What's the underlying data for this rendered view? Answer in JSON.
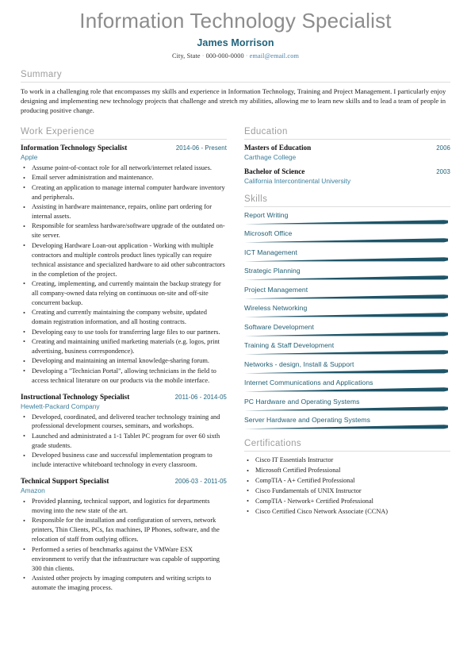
{
  "theme": {
    "accent": "#20637b",
    "accent_light": "#3b7f9c",
    "heading_gray": "#9d9d9d",
    "title_gray": "#8c8c8c",
    "bar_fill": "#1d5468",
    "link_blue": "#4a7fa8"
  },
  "header": {
    "job_title": "Information Technology Specialist",
    "name": "James Morrison",
    "location": "City, State",
    "phone": "000-000-0000",
    "email": "email@email.com",
    "separator": "·"
  },
  "summary": {
    "heading": "Summary",
    "text": "To work in a challenging role that encompasses my skills and experience in Information Technology, Training and Project Management. I particularly enjoy designing and implementing new technology projects that challenge and stretch my abilities, allowing me to learn new skills and to lead a team of people in producing positive change."
  },
  "work_experience": {
    "heading": "Work Experience",
    "entries": [
      {
        "role": "Information Technology Specialist",
        "date": "2014-06 - Present",
        "company": "Apple",
        "bullets": [
          "Assume point-of-contact role for all network/internet related issues.",
          "Email server administration and maintenance.",
          "Creating an application to manage internal computer hardware inventory and peripherals.",
          "Assisting in hardware maintenance, repairs, online part ordering for internal assets.",
          "Responsible for seamless hardware/software upgrade of the outdated on-site server.",
          "Developing Hardware Loan-out application - Working with multiple contractors and multiple controls product lines typically can require technical assistance and specialized hardware to aid other subcontractors in the completion of the project.",
          "Creating, implementing, and currently maintain the backup strategy for all company-owned data relying on continuous on-site and off-site concurrent backup.",
          "Creating and currently maintaining the company website, updated domain registration information, and all hosting contracts.",
          "Developing easy to use tools for transferring large files to our partners.",
          "Creating and maintaining unified marketing materials (e.g. logos, print advertising, business correspondence).",
          "Developing and maintaining an internal knowledge-sharing forum.",
          "Developing a \"Technician Portal\", allowing technicians in the field to access technical literature on our products via the mobile interface."
        ]
      },
      {
        "role": "Instructional Technology Specialist",
        "date": "2011-06 - 2014-05",
        "company": "Hewlett-Packard Company",
        "bullets": [
          "Developed, coordinated, and delivered teacher technology training and professional development courses, seminars, and workshops.",
          "Launched and administrated a 1-1 Tablet PC program for over 60 sixth grade students.",
          "Developed business case and successful implementation program to include interactive whiteboard technology in every classroom."
        ]
      },
      {
        "role": "Technical Support Specialist",
        "date": "2006-03 - 2011-05",
        "company": "Amazon",
        "bullets": [
          "Provided planning, technical support, and logistics for departments moving into the new state of the art.",
          "Responsible for the installation and configuration of servers, network printers, Thin Clients, PCs, fax machines, IP Phones, software, and the relocation of staff from outlying offices.",
          "Performed a series of benchmarks against the VMWare ESX environment to verify that the infrastructure was capable of supporting 300 thin clients.",
          "Assisted other projects by imaging computers and writing scripts to automate the imaging process."
        ]
      }
    ]
  },
  "education": {
    "heading": "Education",
    "entries": [
      {
        "degree": "Masters of Education",
        "year": "2006",
        "school": "Carthage College"
      },
      {
        "degree": "Bachelor of Science",
        "year": "2003",
        "school": "California Intercontinental University"
      }
    ]
  },
  "skills": {
    "heading": "Skills",
    "items": [
      {
        "name": "Report Writing"
      },
      {
        "name": "Microsoft Office"
      },
      {
        "name": "ICT Management"
      },
      {
        "name": "Strategic Planning"
      },
      {
        "name": "Project Management"
      },
      {
        "name": "Wireless Networking"
      },
      {
        "name": "Software Development"
      },
      {
        "name": "Training & Staff Development"
      },
      {
        "name": "Networks - design, Install & Support"
      },
      {
        "name": "Internet Communications and Applications"
      },
      {
        "name": "PC Hardware and Operating Systems"
      },
      {
        "name": "Server Hardware and Operating Systems"
      }
    ]
  },
  "certifications": {
    "heading": "Certifications",
    "items": [
      "Cisco IT Essentials Instructor",
      "Microsoft Certified Professional",
      "CompTIA - A+ Certified Professional",
      "Cisco Fundamentals of UNIX Instructor",
      "CompTIA - Network+ Certified Professional",
      "Cisco Certified Cisco Network Associate (CCNA)"
    ]
  }
}
